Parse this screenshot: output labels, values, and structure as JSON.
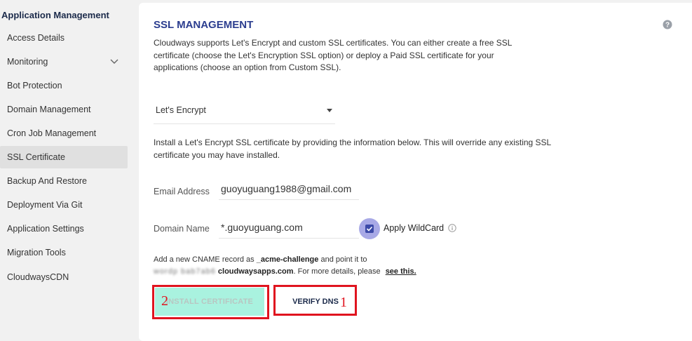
{
  "sidebar": {
    "title": "Application Management",
    "items": [
      {
        "label": "Access Details"
      },
      {
        "label": "Monitoring"
      },
      {
        "label": "Bot Protection"
      },
      {
        "label": "Domain Management"
      },
      {
        "label": "Cron Job Management"
      },
      {
        "label": "SSL Certificate"
      },
      {
        "label": "Backup And Restore"
      },
      {
        "label": "Deployment Via Git"
      },
      {
        "label": "Application Settings"
      },
      {
        "label": "Migration Tools"
      },
      {
        "label": "CloudwaysCDN"
      }
    ],
    "active": "SSL Certificate"
  },
  "main": {
    "title": "SSL MANAGEMENT",
    "description": "Cloudways supports Let's Encrypt and custom SSL certificates. You can either create a free SSL certificate (choose the Let's Encryption SSL option) or deploy a Paid SSL certificate for your applications (choose an option from Custom SSL).",
    "ssl_type": {
      "selected": "Let's Encrypt"
    },
    "info": "Install a Let's Encrypt SSL certificate by providing the information below. This will override any existing SSL certificate you may have installed.",
    "email": {
      "label": "Email Address",
      "value": "guoyuguang1988@gmail.com"
    },
    "domain": {
      "label": "Domain Name",
      "value": "*.guoyuguang.com"
    },
    "wildcard": {
      "label": "Apply WildCard",
      "checked": true
    },
    "cname": {
      "prefix": "Add a new CNAME record as",
      "record": "_acme-challenge",
      "middle": "and point it to",
      "target_redacted": "wordp      bab7ab6",
      "target_domain": "cloudwaysapps.com",
      "suffix": ". For more details, please",
      "link": "see this."
    },
    "buttons": {
      "install": "INSTALL CERTIFICATE",
      "verify": "VERIFY DNS"
    }
  },
  "annotations": {
    "install_number": "2",
    "verify_number": "1",
    "color": "#e0141f"
  },
  "colors": {
    "accent": "#2b3d8f",
    "install_bg": "#a9f2df",
    "checkbox": "#3c4aa8"
  },
  "icons": {
    "help": "question-circle-icon",
    "info": "info-circle-icon",
    "chevron": "chevron-down-icon"
  }
}
